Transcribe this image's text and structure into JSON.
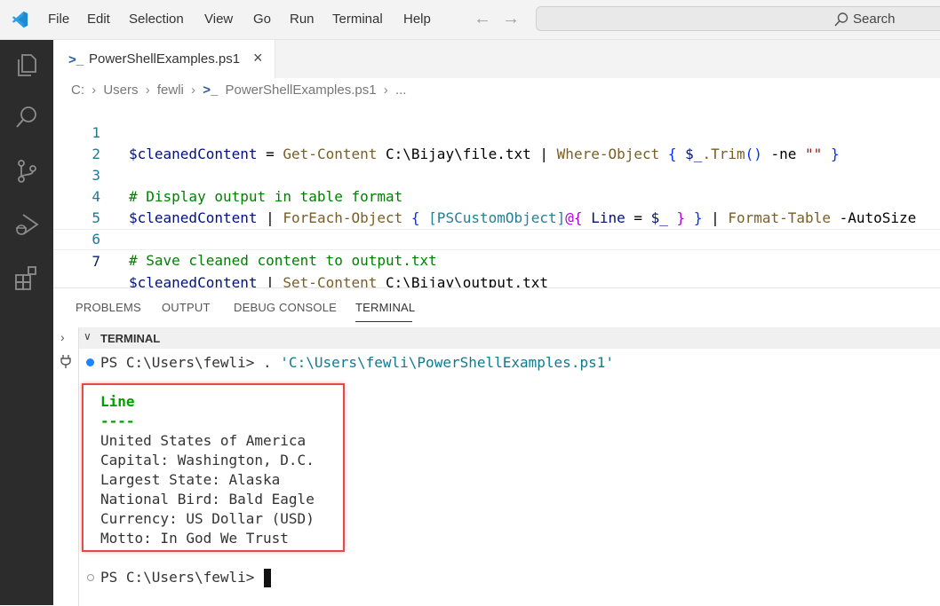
{
  "menu": {
    "items": [
      "File",
      "Edit",
      "Selection",
      "View",
      "Go",
      "Run",
      "Terminal",
      "Help"
    ],
    "back_icon": "arrow-left",
    "forward_icon": "arrow-right"
  },
  "search": {
    "label": "Search"
  },
  "activity_bar": {
    "icons": [
      "explorer-icon",
      "search-icon",
      "source-control-icon",
      "run-debug-icon",
      "extensions-icon"
    ]
  },
  "editor": {
    "tab": {
      "label": "PowerShellExamples.ps1",
      "close": "×",
      "icon": ">_"
    },
    "breadcrumb": [
      "C:",
      "Users",
      "fewli",
      "PowerShellExamples.ps1",
      "..."
    ],
    "line_numbers": [
      "1",
      "2",
      "3",
      "4",
      "5",
      "6",
      "7"
    ],
    "lines": {
      "l1": [
        {
          "t": "$cleanedContent",
          "c": "t-var"
        },
        {
          "t": " = ",
          "c": "t-op"
        },
        {
          "t": "Get-Content",
          "c": "t-cmd"
        },
        {
          "t": " C:\\Bijay\\file.txt ",
          "c": "t-plain"
        },
        {
          "t": "| ",
          "c": "t-op"
        },
        {
          "t": "Where-Object",
          "c": "t-cmd"
        },
        {
          "t": " { ",
          "c": "t-br"
        },
        {
          "t": "$_",
          "c": "t-var"
        },
        {
          "t": ".Trim",
          "c": "t-cmd"
        },
        {
          "t": "()",
          "c": "t-br"
        },
        {
          "t": " -ne ",
          "c": "t-plain"
        },
        {
          "t": "\"\"",
          "c": "t-str"
        },
        {
          "t": " }",
          "c": "t-br"
        }
      ],
      "l3": [
        {
          "t": "# Display output in table format",
          "c": "t-cmt"
        }
      ],
      "l4": [
        {
          "t": "$cleanedContent",
          "c": "t-var"
        },
        {
          "t": " | ",
          "c": "t-op"
        },
        {
          "t": "ForEach-Object",
          "c": "t-cmd"
        },
        {
          "t": " { ",
          "c": "t-br"
        },
        {
          "t": "[PSCustomObject]",
          "c": "t-type"
        },
        {
          "t": "@{ ",
          "c": "t-kw"
        },
        {
          "t": "Line",
          "c": "t-var"
        },
        {
          "t": " = ",
          "c": "t-op"
        },
        {
          "t": "$_",
          "c": "t-var"
        },
        {
          "t": " } ",
          "c": "t-kw"
        },
        {
          "t": "}",
          "c": "t-br"
        },
        {
          "t": " | ",
          "c": "t-op"
        },
        {
          "t": "Format-Table",
          "c": "t-cmd"
        },
        {
          "t": " -AutoSize",
          "c": "t-plain"
        }
      ],
      "l6": [
        {
          "t": "# Save cleaned content to output.txt",
          "c": "t-cmt"
        }
      ],
      "l7": [
        {
          "t": "$cleanedContent",
          "c": "t-var"
        },
        {
          "t": " | ",
          "c": "t-op"
        },
        {
          "t": "Set-Content",
          "c": "t-cmd"
        },
        {
          "t": " C:\\Bijay\\output.txt",
          "c": "t-plain"
        }
      ]
    }
  },
  "panel": {
    "tabs": [
      "PROBLEMS",
      "OUTPUT",
      "DEBUG CONSOLE",
      "TERMINAL"
    ],
    "terminal_header": "TERMINAL",
    "command_prompt": "PS C:\\Users\\fewli> . ",
    "command_arg": "'C:\\Users\\fewli\\PowerShellExamples.ps1'",
    "table_header": "Line",
    "table_rule": "----",
    "output": [
      "United States of America",
      "Capital: Washington, D.C.",
      "Largest State: Alaska",
      "National Bird: Bald Eagle",
      "Currency: US Dollar (USD)",
      "Motto: In God We Trust"
    ],
    "final_prompt": "PS C:\\Users\\fewli> "
  },
  "colors": {
    "activity_bar": "#2c2c2c",
    "accent_blue": "#1a85ff",
    "highlight_box": "#e04b4b",
    "terminal_header_green": "#00a000",
    "string_teal": "#0e7b8f"
  }
}
